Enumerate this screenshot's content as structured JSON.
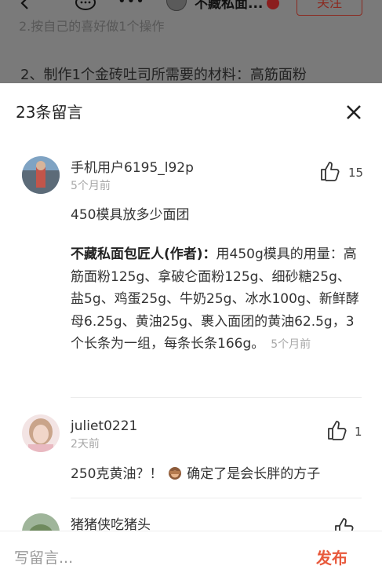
{
  "header": {
    "author_name": "不藏私面...",
    "follow_label": "关注",
    "icons": [
      "back-icon",
      "chat-icon",
      "more-icon",
      "avatar",
      "badge-icon"
    ]
  },
  "article": {
    "line1": "2.按自己的喜好做1个操作",
    "line2": "2、制作1个金砖吐司所需要的材料：高筋面粉"
  },
  "sheet": {
    "title": "23条留言",
    "close_icon": "close-icon"
  },
  "comments": [
    {
      "name": "手机用户6195_l92p",
      "time": "5个月前",
      "likes": "15",
      "text": "450模具放多少面团",
      "reply": {
        "author": "不藏私面包匠人(作者)：",
        "text": "用450g模具的用量：高筋面粉125g、拿破仑面粉125g、细砂糖25g、盐5g、鸡蛋25g、牛奶25g、冰水100g、新鲜酵母6.25g、黄油25g、裹入面团的黄油62.5g，3个长条为一组，每条长条166g。",
        "time": "5个月前"
      }
    },
    {
      "name": "juliet0221",
      "time": "2天前",
      "likes": "1",
      "text_before": "250克黄油？！",
      "emoji": "see-no-evil-monkey-icon",
      "text_after": "确定了是会长胖的方子"
    },
    {
      "name": "猪猪侠吃猪头"
    }
  ],
  "input_bar": {
    "placeholder": "写留言...",
    "publish_label": "发布"
  },
  "colors": {
    "accent": "#e8593c",
    "follow": "#8b2a20",
    "muted": "#a8a8a8",
    "backdrop": "#7a7a7a"
  }
}
